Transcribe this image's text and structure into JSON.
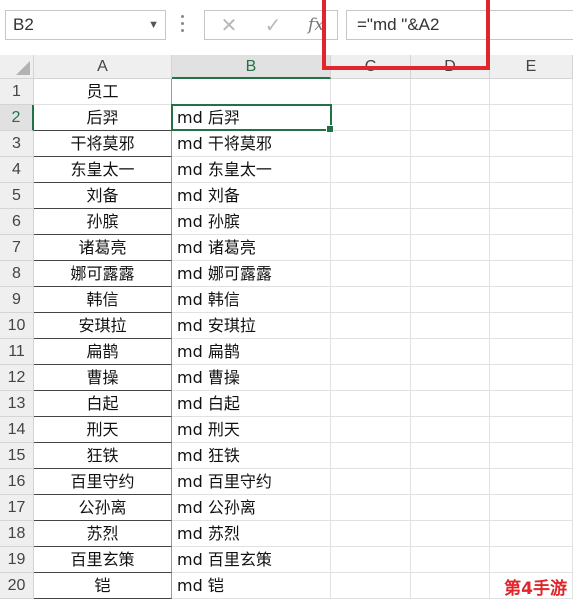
{
  "name_box": {
    "value": "B2",
    "dropdown_icon": "chevron-down-icon"
  },
  "formula_bar": {
    "cancel_icon": "cancel-x-icon",
    "enter_icon": "checkmark-icon",
    "fx_label": "fx",
    "formula": "=\"md \"&A2"
  },
  "columns": [
    "A",
    "B",
    "C",
    "D",
    "E"
  ],
  "rows": [
    {
      "num": "1",
      "a": "员工",
      "b": ""
    },
    {
      "num": "2",
      "a": "后羿",
      "b": "md 后羿"
    },
    {
      "num": "3",
      "a": "干将莫邪",
      "b": "md 干将莫邪"
    },
    {
      "num": "4",
      "a": "东皇太一",
      "b": "md 东皇太一"
    },
    {
      "num": "5",
      "a": "刘备",
      "b": "md 刘备"
    },
    {
      "num": "6",
      "a": "孙膑",
      "b": "md 孙膑"
    },
    {
      "num": "7",
      "a": "诸葛亮",
      "b": "md 诸葛亮"
    },
    {
      "num": "8",
      "a": "娜可露露",
      "b": "md 娜可露露"
    },
    {
      "num": "9",
      "a": "韩信",
      "b": "md 韩信"
    },
    {
      "num": "10",
      "a": "安琪拉",
      "b": "md 安琪拉"
    },
    {
      "num": "11",
      "a": "扁鹊",
      "b": "md 扁鹊"
    },
    {
      "num": "12",
      "a": "曹操",
      "b": "md 曹操"
    },
    {
      "num": "13",
      "a": "白起",
      "b": "md 白起"
    },
    {
      "num": "14",
      "a": "刑天",
      "b": "md 刑天"
    },
    {
      "num": "15",
      "a": "狂铁",
      "b": "md 狂铁"
    },
    {
      "num": "16",
      "a": "百里守约",
      "b": "md 百里守约"
    },
    {
      "num": "17",
      "a": "公孙离",
      "b": "md 公孙离"
    },
    {
      "num": "18",
      "a": "苏烈",
      "b": "md 苏烈"
    },
    {
      "num": "19",
      "a": "百里玄策",
      "b": "md 百里玄策"
    },
    {
      "num": "20",
      "a": "铠",
      "b": "md 铠"
    }
  ],
  "watermark": "第4手游",
  "colors": {
    "accent": "#217346",
    "highlight": "#e0262b"
  }
}
